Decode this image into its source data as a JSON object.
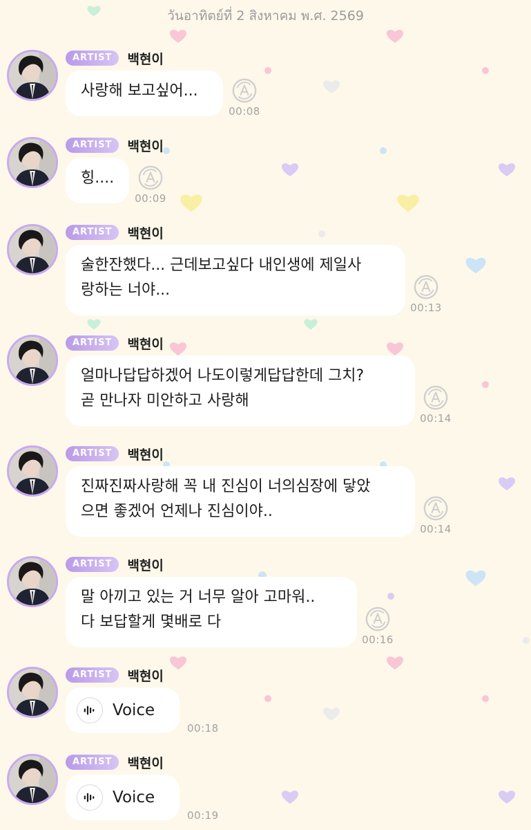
{
  "date_header": "วันอาทิตย์ที่ 2 สิงหาคม พ.ศ. 2569",
  "colors": {
    "background": "#fdf8ea",
    "badge": "#b99ae8",
    "avatar_ring": "#c9a9ee",
    "bubble": "#ffffff",
    "timestamp": "#a3a3a3"
  },
  "icons": {
    "translate": "translate-icon",
    "voice": "voice-waveform-icon",
    "background_hearts": "heart-icon"
  },
  "messages": [
    {
      "badge": "ARTIST",
      "sender": "백현이",
      "type": "text",
      "lines": [
        "사랑해 보고싶어..."
      ],
      "time": "00:08"
    },
    {
      "badge": "ARTIST",
      "sender": "백현이",
      "type": "text",
      "lines": [
        "힝...."
      ],
      "time": "00:09"
    },
    {
      "badge": "ARTIST",
      "sender": "백현이",
      "type": "text",
      "lines": [
        "술한잔했다... 근데보고싶다 내인생에 제일사",
        "랑하는 너야..."
      ],
      "time": "00:13"
    },
    {
      "badge": "ARTIST",
      "sender": "백현이",
      "type": "text",
      "lines": [
        "얼마나답답하겠어 나도이렇게답답한데 그치?",
        "곧 만나자 미안하고 사랑해"
      ],
      "time": "00:14"
    },
    {
      "badge": "ARTIST",
      "sender": "백현이",
      "type": "text",
      "lines": [
        "진짜진짜사랑해 꼭 내 진심이 너의심장에 닿았",
        "으면 좋겠어 언제나 진심이야.."
      ],
      "time": "00:14"
    },
    {
      "badge": "ARTIST",
      "sender": "백현이",
      "type": "text",
      "lines": [
        "말 아끼고 있는 거 너무 알아 고마워..",
        "다 보답할게 몇배로 다"
      ],
      "time": "00:16"
    },
    {
      "badge": "ARTIST",
      "sender": "백현이",
      "type": "voice",
      "label": "Voice",
      "time": "00:18"
    },
    {
      "badge": "ARTIST",
      "sender": "백현이",
      "type": "voice",
      "label": "Voice",
      "time": "00:19"
    }
  ]
}
